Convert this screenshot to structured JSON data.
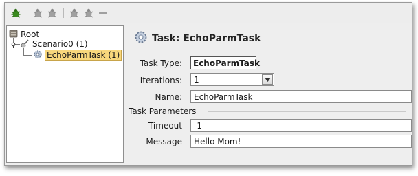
{
  "toolbar": {
    "buttons": [
      {
        "icon": "bug-green-icon"
      },
      {
        "icon": "bug-gray-icon"
      },
      {
        "icon": "bug-gray-icon"
      },
      {
        "icon": "bug-gray-icon"
      },
      {
        "icon": "bug-gray-icon"
      },
      {
        "icon": "remove-icon"
      }
    ]
  },
  "tree": {
    "root": {
      "label": "Root"
    },
    "scenario": {
      "label": "Scenario0 (1)"
    },
    "task": {
      "label": "EchoParmTask (1)"
    }
  },
  "detail": {
    "title": "Task: EchoParmTask",
    "task_type_label": "Task Type:",
    "task_type_value": "EchoParmTask",
    "iterations_label": "Iterations:",
    "iterations_value": "1",
    "name_label": "Name:",
    "name_value": "EchoParmTask",
    "params_section": "Task Parameters",
    "timeout_label": "Timeout",
    "timeout_value": "-1",
    "message_label": "Message",
    "message_value": "Hello Mom!"
  },
  "colors": {
    "selection": "#f8d77c",
    "bug_active": "#3a8a1e",
    "bug_inactive": "#9a9a9a"
  }
}
